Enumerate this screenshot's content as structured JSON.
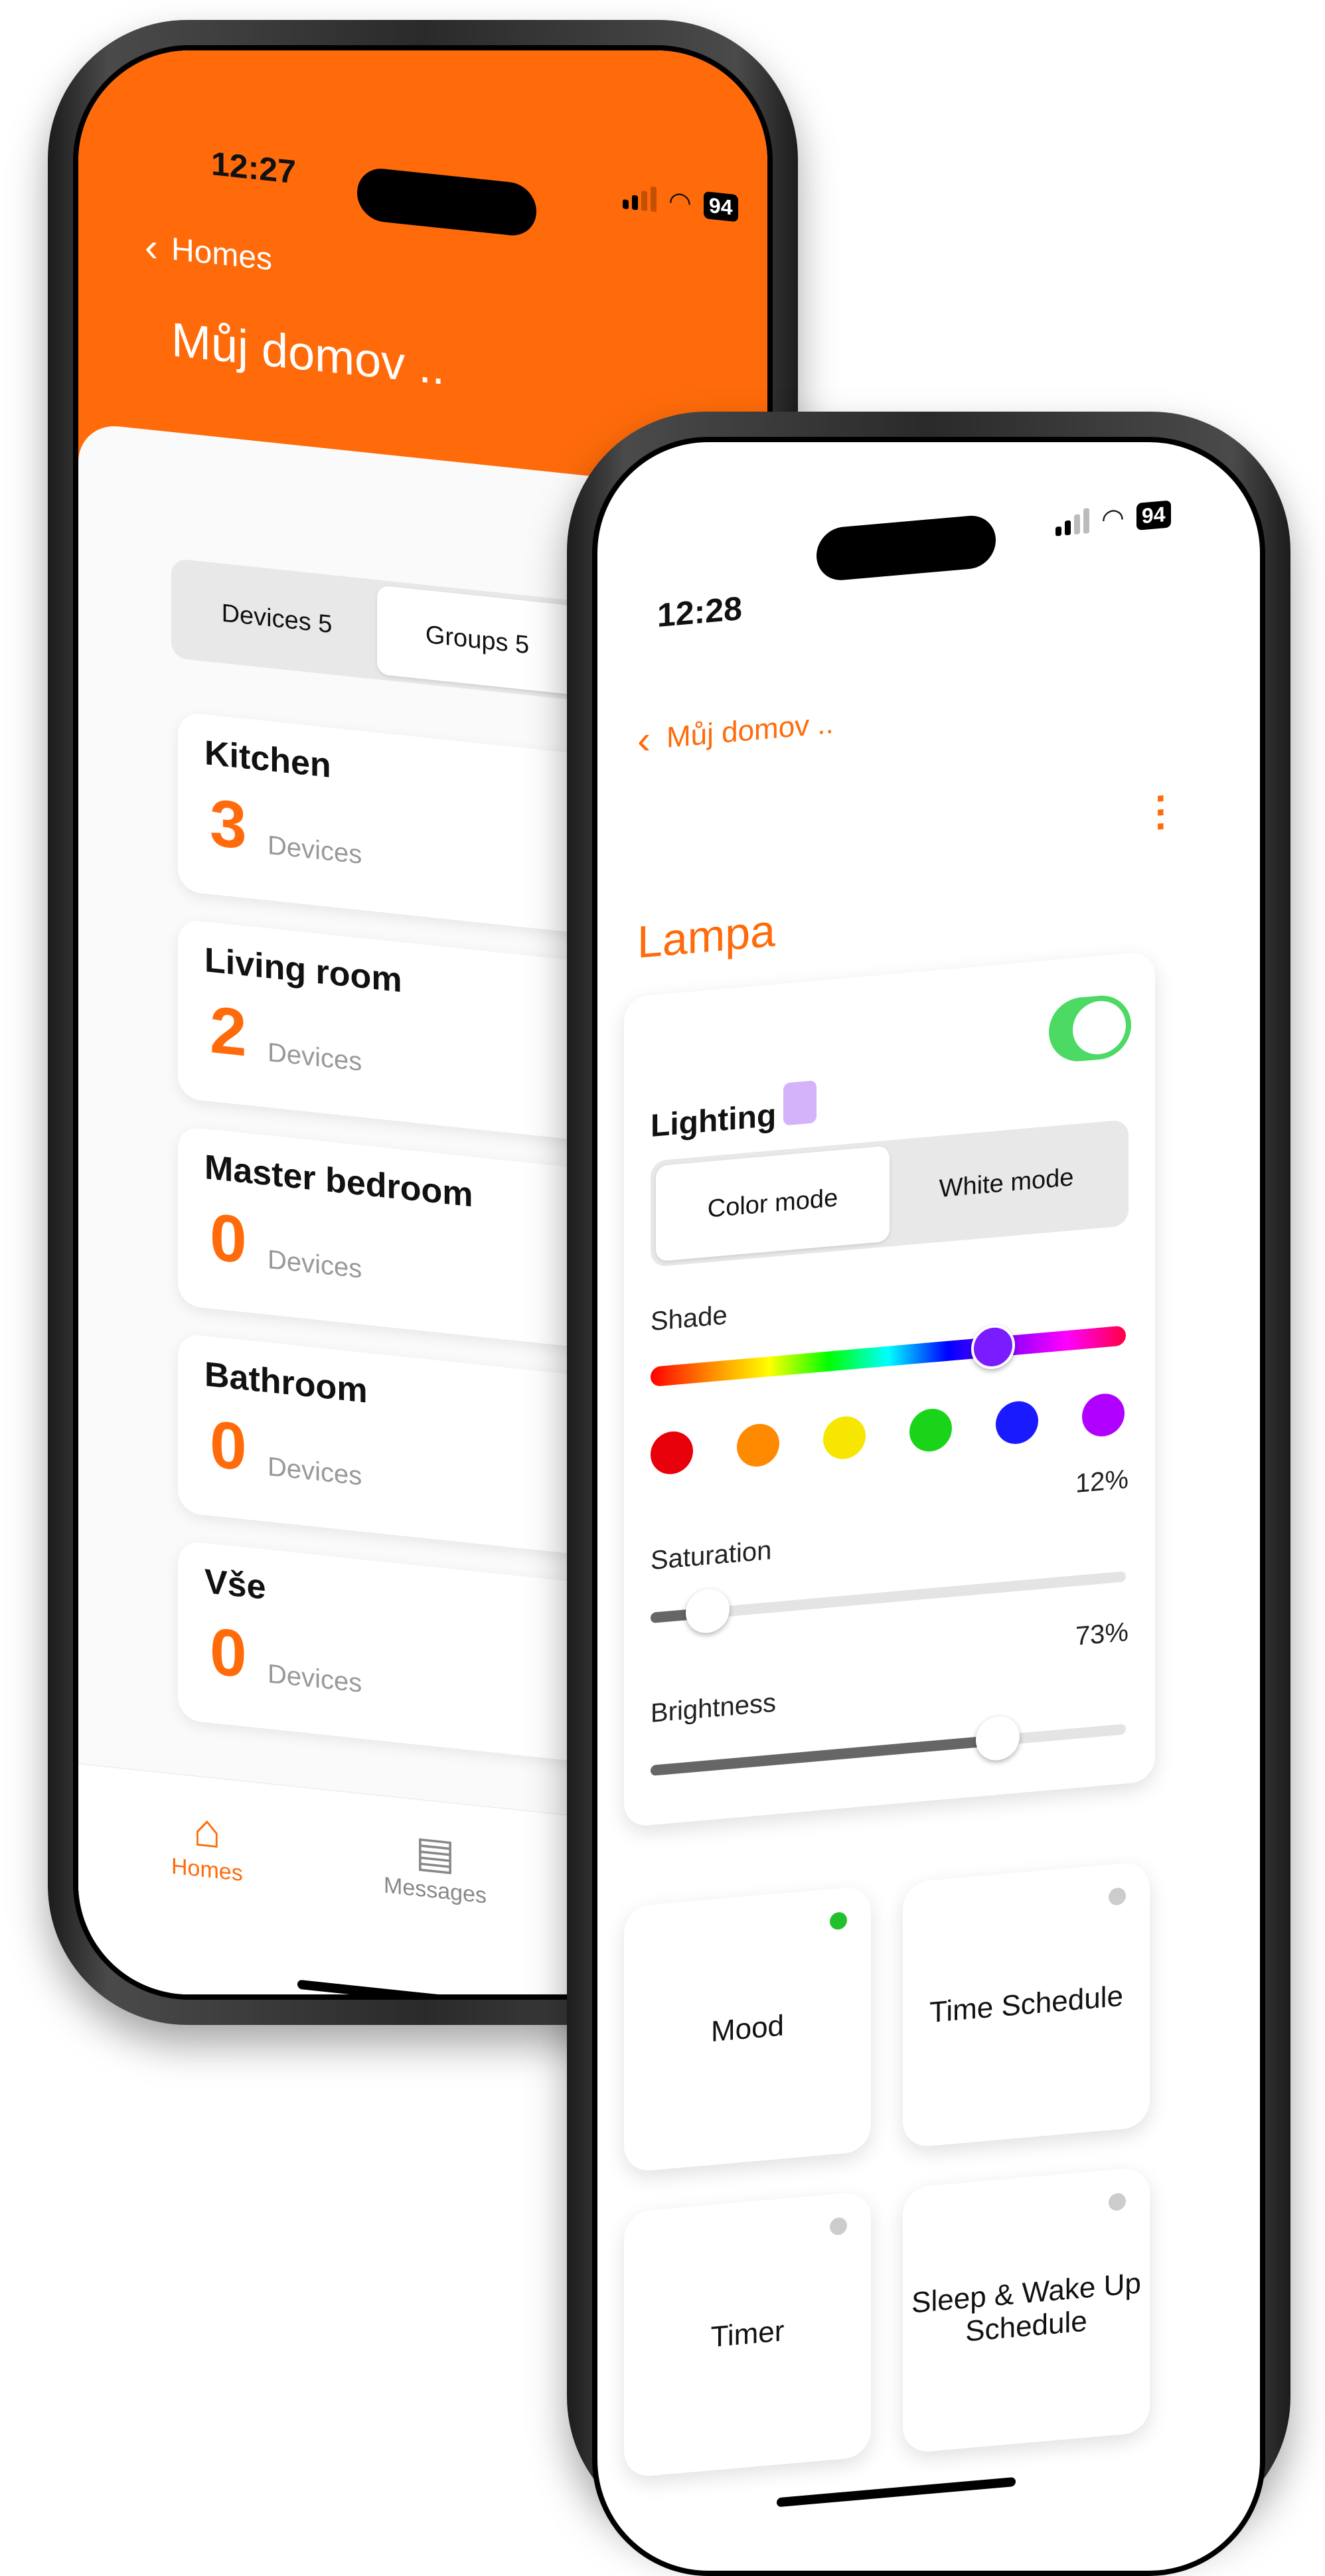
{
  "phone_back": {
    "status": {
      "time": "12:27",
      "battery": "94"
    },
    "nav": {
      "back_label": "Homes"
    },
    "title": "Můj domov ..",
    "segment": {
      "devices": "Devices 5",
      "groups": "Groups 5",
      "selected": "groups"
    },
    "groups": [
      {
        "name": "Kitchen",
        "count": "3",
        "unit": "Devices"
      },
      {
        "name": "Living room",
        "count": "2",
        "unit": "Devices"
      },
      {
        "name": "Master bedroom",
        "count": "0",
        "unit": "Devices"
      },
      {
        "name": "Bathroom",
        "count": "0",
        "unit": "Devices"
      },
      {
        "name": "Vše",
        "count": "0",
        "unit": "Devices"
      }
    ],
    "tabs": [
      {
        "label": "Homes",
        "icon": "home-icon",
        "active": true
      },
      {
        "label": "Messages",
        "icon": "messages-icon",
        "active": false
      }
    ]
  },
  "phone_front": {
    "status": {
      "time": "12:28",
      "battery": "94"
    },
    "nav": {
      "back_label": "Můj domov .."
    },
    "device_title": "Lampa",
    "lighting": {
      "label": "Lighting",
      "on": true,
      "color_swatch": "#d4b3fb",
      "modes": {
        "color": "Color mode",
        "white": "White mode",
        "selected": "color"
      },
      "shade_label": "Shade",
      "shade_position": 0.72,
      "preset_colors": [
        "#e8000b",
        "#ff8a00",
        "#f7e600",
        "#19d419",
        "#1a1aff",
        "#b000ff"
      ],
      "saturation_label": "Saturation",
      "saturation_value": "12%",
      "saturation": 0.12,
      "brightness_label": "Brightness",
      "brightness_value": "73%",
      "brightness": 0.73
    },
    "tiles": [
      {
        "label": "Mood",
        "active": true
      },
      {
        "label": "Time Schedule",
        "active": false
      },
      {
        "label": "Timer",
        "active": false
      },
      {
        "label": "Sleep & Wake Up\nSchedule",
        "active": false
      }
    ]
  },
  "colors": {
    "accent": "#ff6b0a",
    "toggle_on": "#4cd964",
    "indicator_on": "#22c02c"
  }
}
